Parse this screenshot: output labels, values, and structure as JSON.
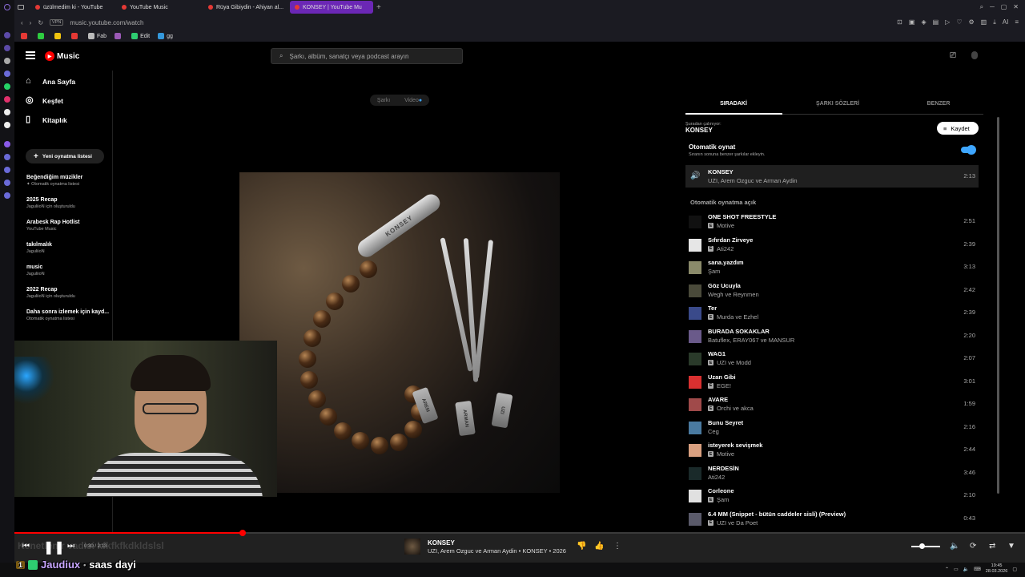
{
  "browser": {
    "tabs": [
      {
        "label": "üzülmedim ki - YouTube",
        "active": false
      },
      {
        "label": "YouTube Music",
        "active": false
      },
      {
        "label": "Rüya Gibiydin - Ahiyan al...",
        "active": false
      },
      {
        "label": "KONSEY | YouTube Mu",
        "active": true
      }
    ],
    "url_badge": "VPN",
    "url": "music.youtube.com/watch",
    "bookmarks": [
      "Fab",
      "Edit",
      "gg"
    ],
    "ai_label": "AI"
  },
  "header": {
    "logo_text": "Music",
    "search_placeholder": "Şarkı, albüm, sanatçı veya podcast arayın"
  },
  "sidebar": {
    "nav": [
      {
        "label": "Ana Sayfa",
        "icon": "home-icon"
      },
      {
        "label": "Keşfet",
        "icon": "compass-icon"
      },
      {
        "label": "Kitaplık",
        "icon": "library-icon"
      }
    ],
    "new_playlist_label": "Yeni oynatma listesi",
    "playlists": [
      {
        "title": "Beğendiğim müzikler",
        "subtitle": "Otomatik oynatma listesi"
      },
      {
        "title": "2025 Recap",
        "subtitle": "JaguliioN için oluşturuldu"
      },
      {
        "title": "Arabesk Rap Hotlist",
        "subtitle": "YouTube Music"
      },
      {
        "title": "takılmalık",
        "subtitle": "JaguliioN"
      },
      {
        "title": "music",
        "subtitle": "JaguliioN"
      },
      {
        "title": "2022 Recap",
        "subtitle": "JaguliioN için oluşturuldu"
      },
      {
        "title": "Daha sonra izlemek için kayd...",
        "subtitle": "Otomatik oynatma listesi"
      }
    ]
  },
  "main": {
    "toggle": {
      "song": "Şarkı",
      "video": "Video"
    },
    "artwork_tags": [
      "KONSEY",
      "AREM",
      "ARMAN",
      "UZI"
    ]
  },
  "panel": {
    "tabs": [
      "SIRADAKİ",
      "ŞARKI SÖZLERİ",
      "BENZER"
    ],
    "source_label": "Şuradan çalınıyor:",
    "source_name": "KONSEY",
    "save_label": "Kaydet",
    "autoplay_title": "Otomatik oynat",
    "autoplay_sub": "Sıranın sonuna benzer şarkılar ekleyin.",
    "autoplay_on": true,
    "current": {
      "title": "KONSEY",
      "artist": "UZI, Arem Ozguc ve Arman Aydin",
      "duration": "2:13"
    },
    "autoplay_header": "Otomatik oynatma açık",
    "queue": [
      {
        "title": "ONE SHOT FREESTYLE",
        "artist": "Motive",
        "duration": "2:51",
        "explicit": true,
        "thumb_color": "#111111"
      },
      {
        "title": "Sıfırdan Zirveye",
        "artist": "Ati242",
        "duration": "2:39",
        "explicit": true,
        "thumb_color": "#e6e6e6"
      },
      {
        "title": "sana.yazdım",
        "artist": "Şam",
        "duration": "3:13",
        "explicit": false,
        "thumb_color": "#8a8a6a"
      },
      {
        "title": "Göz Ucuyla",
        "artist": "Wegh ve Reynmen",
        "duration": "2:42",
        "explicit": false,
        "thumb_color": "#4a4a3a"
      },
      {
        "title": "Ter",
        "artist": "Murda ve Ezhel",
        "duration": "2:39",
        "explicit": true,
        "thumb_color": "#3a4a8a"
      },
      {
        "title": "BURADA SOKAKLAR",
        "artist": "Batuflex, ERAY067 ve MANSUR",
        "duration": "2:20",
        "explicit": false,
        "thumb_color": "#6a5a8a"
      },
      {
        "title": "WAG1",
        "artist": "UZI ve Modd",
        "duration": "2:07",
        "explicit": true,
        "thumb_color": "#2a3a2a"
      },
      {
        "title": "Uzan Gibi",
        "artist": "EGE!",
        "duration": "3:01",
        "explicit": true,
        "thumb_color": "#d93030"
      },
      {
        "title": "AVARE",
        "artist": "Orchi ve akca",
        "duration": "1:59",
        "explicit": true,
        "thumb_color": "#a04a4a"
      },
      {
        "title": "Bunu Seyret",
        "artist": "Ceg",
        "duration": "2:16",
        "explicit": false,
        "thumb_color": "#4a7aa0"
      },
      {
        "title": "isteyerek sevişmek",
        "artist": "Motive",
        "duration": "2:44",
        "explicit": true,
        "thumb_color": "#d9a080"
      },
      {
        "title": "NERDESİN",
        "artist": "Ati242",
        "duration": "3:46",
        "explicit": false,
        "thumb_color": "#1a2a2a"
      },
      {
        "title": "Corleone",
        "artist": "Şam",
        "duration": "2:10",
        "explicit": true,
        "thumb_color": "#e0e0e0"
      },
      {
        "title": "6.4 MM (Snippet - bütün caddeler sisli) (Preview)",
        "artist": "UZI ve Da Poet",
        "duration": "0:43",
        "explicit": true,
        "thumb_color": "#5a5a6a"
      }
    ]
  },
  "player": {
    "time": "0:30 / 2:13",
    "progress": 0.2256,
    "volume": 0.35,
    "now_playing_title": "KONSEY",
    "now_playing_sub": "UZI, Arem Ozguc ve Arman Aydin • KONSEY • 2026"
  },
  "overlay": {
    "faint_text": "Kenetlenir vadisi kfkfkfkdkldslsl",
    "chat_badge": "1",
    "chat_user": "Jaudiux",
    "chat_message": "saas dayi"
  },
  "taskbar": {
    "time": "19:45",
    "date": "28.03.2026"
  },
  "colors": {
    "accent": "#ff0000",
    "toggle": "#3ea6ff",
    "active_tab": "#6b27b5"
  }
}
